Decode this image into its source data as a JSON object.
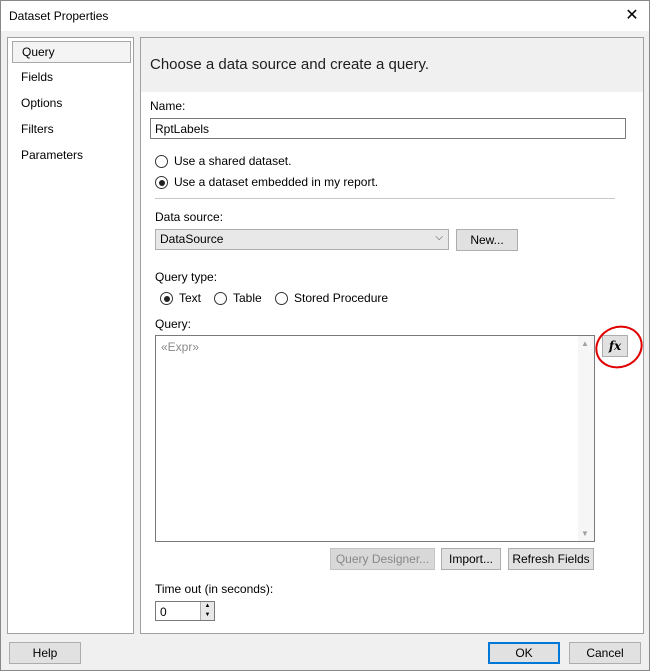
{
  "window": {
    "title": "Dataset Properties",
    "close_icon": "close-icon"
  },
  "nav": {
    "items": [
      {
        "label": "Query",
        "selected": true
      },
      {
        "label": "Fields"
      },
      {
        "label": "Options"
      },
      {
        "label": "Filters"
      },
      {
        "label": "Parameters"
      }
    ]
  },
  "query_page": {
    "heading": "Choose a data source and create a query.",
    "name_label": "Name:",
    "name_value": "RptLabels",
    "radio_shared_label": "Use a shared dataset.",
    "radio_embedded_label": "Use a dataset embedded in my report.",
    "data_source_label": "Data source:",
    "data_source_value": "DataSource",
    "new_button": "New...",
    "query_type_label": "Query type:",
    "query_type_text": "Text",
    "query_type_table": "Table",
    "query_type_stored_procedure": "Stored Procedure",
    "query_label": "Query:",
    "query_placeholder": "«Expr»",
    "fx_icon": "fx-expression-icon",
    "query_designer_button": "Query Designer...",
    "import_button": "Import...",
    "refresh_fields_button": "Refresh Fields",
    "timeout_label": "Time out (in seconds):",
    "timeout_value": "0"
  },
  "footer": {
    "help": "Help",
    "ok": "OK",
    "cancel": "Cancel"
  },
  "colors": {
    "annotation": "#e00000",
    "default_button_border": "#0078d7"
  }
}
